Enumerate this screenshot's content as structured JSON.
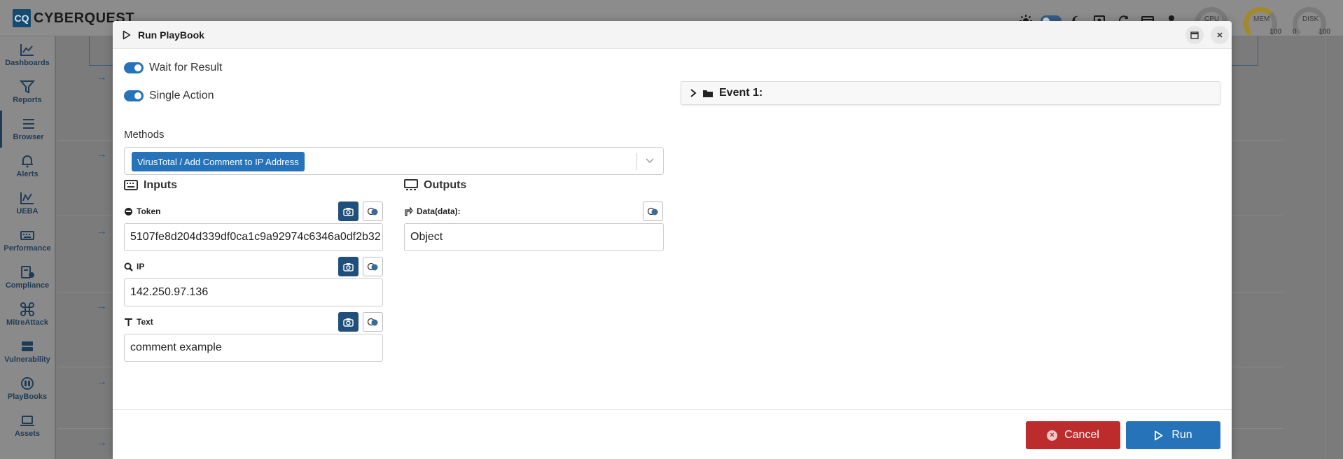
{
  "app": {
    "logo_mark": "CQ",
    "logo_text": "CYBERQUEST"
  },
  "topbar": {
    "gauges": [
      {
        "label": "CPU",
        "min": "",
        "max": ""
      },
      {
        "label": "MEM",
        "min": "",
        "max": "100"
      },
      {
        "label": "DISK",
        "min": "0",
        "max": "100"
      }
    ]
  },
  "sidebar": {
    "items": [
      {
        "label": "Dashboards",
        "icon": "chart-line-icon"
      },
      {
        "label": "Reports",
        "icon": "filter-icon"
      },
      {
        "label": "Browser",
        "icon": "list-icon"
      },
      {
        "label": "Alerts",
        "icon": "bell-icon"
      },
      {
        "label": "UEBA",
        "icon": "chart-bars-icon"
      },
      {
        "label": "Performance",
        "icon": "keyboard-icon"
      },
      {
        "label": "Compliance",
        "icon": "compliance-icon"
      },
      {
        "label": "MitreAttack",
        "icon": "command-icon"
      },
      {
        "label": "Vulnerability",
        "icon": "server-icon"
      },
      {
        "label": "PlayBooks",
        "icon": "playbook-icon"
      },
      {
        "label": "Assets",
        "icon": "laptop-icon"
      }
    ]
  },
  "modal": {
    "title": "Run PlayBook",
    "wait_for_result": {
      "label": "Wait for Result",
      "on": true
    },
    "single_action": {
      "label": "Single Action",
      "on": true
    },
    "methods": {
      "label": "Methods",
      "selected": "VirusTotal / Add Comment to IP Address"
    },
    "inputs": {
      "title": "Inputs",
      "fields": [
        {
          "label": "Token",
          "value": "5107fe8d204d339df0ca1c9a92974c6346a0df2b32"
        },
        {
          "label": "IP",
          "value": "142.250.97.136"
        },
        {
          "label": "Text",
          "value": "comment example"
        }
      ]
    },
    "outputs": {
      "title": "Outputs",
      "fields": [
        {
          "label": "Data(data):",
          "value": "Object"
        }
      ]
    },
    "event": {
      "label": "Event 1:"
    },
    "footer": {
      "cancel_label": "Cancel",
      "run_label": "Run"
    }
  }
}
